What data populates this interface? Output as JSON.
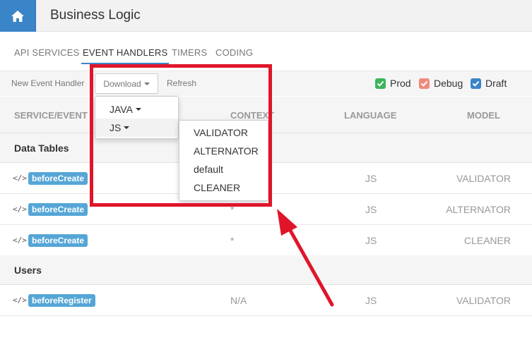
{
  "header": {
    "title": "Business Logic",
    "home_icon": "home-icon",
    "accent": "#3a84c8"
  },
  "tabs": [
    {
      "label": "API SERVICES"
    },
    {
      "label": "EVENT HANDLERS",
      "active": true
    },
    {
      "label": "TIMERS"
    },
    {
      "label": "CODING"
    }
  ],
  "toolbar": {
    "new_label": "New Event Handler",
    "download_label": "Download",
    "refresh_label": "Refresh",
    "filters": [
      {
        "label": "Prod",
        "color": "#3cb55a",
        "checked": true
      },
      {
        "label": "Debug",
        "color": "#f08a7e",
        "checked": true
      },
      {
        "label": "Draft",
        "color": "#3a84c8",
        "checked": true
      }
    ]
  },
  "table": {
    "columns": [
      "SERVICE/EVENT",
      "CONTEXT",
      "LANGUAGE",
      "MODEL"
    ],
    "groups": [
      {
        "label": "Data Tables",
        "rows": [
          {
            "event": "beforeCreate",
            "context": "",
            "language": "JS",
            "model": "VALIDATOR"
          },
          {
            "event": "beforeCreate",
            "context": "*",
            "language": "JS",
            "model": "ALTERNATOR"
          },
          {
            "event": "beforeCreate",
            "context": "*",
            "language": "JS",
            "model": "CLEANER"
          }
        ]
      },
      {
        "label": "Users",
        "rows": [
          {
            "event": "beforeRegister",
            "context": "N/A",
            "language": "JS",
            "model": "VALIDATOR"
          }
        ]
      }
    ]
  },
  "download_menu": {
    "items": [
      {
        "label": "JAVA"
      },
      {
        "label": "JS"
      }
    ],
    "js_submenu": [
      "VALIDATOR",
      "ALTERNATOR",
      "default",
      "CLEANER"
    ]
  },
  "annotation": {
    "color": "#e0152a"
  }
}
